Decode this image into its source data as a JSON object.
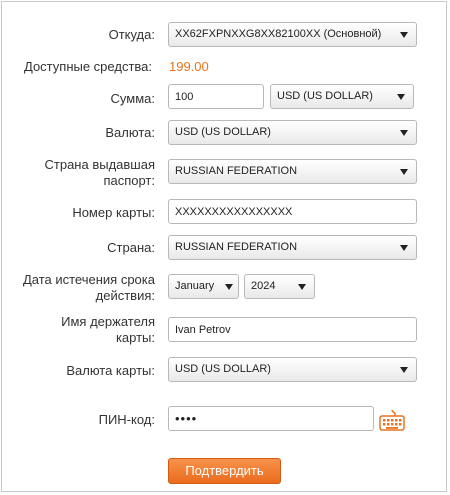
{
  "form": {
    "from": {
      "label": "Откуда:",
      "value": "XX62FXPNXXG8XX82100XX (Основной)"
    },
    "available": {
      "label": "Доступные средства:",
      "value": "199.00"
    },
    "amount": {
      "label": "Сумма:",
      "value": "100",
      "currency": "USD (US DOLLAR)"
    },
    "currency": {
      "label": "Валюта:",
      "value": "USD (US DOLLAR)"
    },
    "passport_country": {
      "label_line1": "Страна выдавшая",
      "label_line2": "паспорт:",
      "value": "RUSSIAN FEDERATION"
    },
    "card_number": {
      "label": "Номер карты:",
      "value": "XXXXXXXXXXXXXXXX"
    },
    "country": {
      "label": "Страна:",
      "value": "RUSSIAN FEDERATION"
    },
    "expiry": {
      "label_line1": "Дата истечения срока",
      "label_line2": "действия:",
      "month": "January",
      "year": "2024"
    },
    "holder": {
      "label_line1": "Имя держателя",
      "label_line2": "карты:",
      "value": "Ivan Petrov"
    },
    "card_currency": {
      "label": "Валюта карты:",
      "value": "USD (US DOLLAR)"
    },
    "pin": {
      "label": "ПИН-код:",
      "value": "••••"
    },
    "submit_label": "Подтвердить"
  },
  "colors": {
    "accent": "#e8731d",
    "button": "#ea6b1e"
  },
  "icons": {
    "virtual_keyboard": "keyboard-icon"
  }
}
